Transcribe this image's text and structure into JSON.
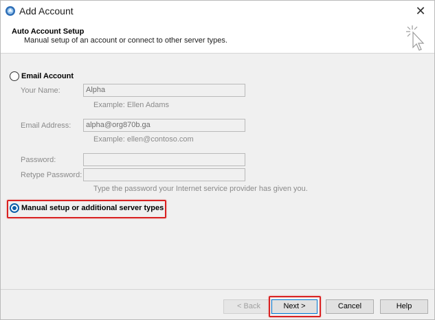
{
  "window": {
    "title": "Add Account",
    "close_glyph": "✕"
  },
  "header": {
    "title": "Auto Account Setup",
    "subtitle": "Manual setup of an account or connect to other server types.",
    "icon": "cursor-sparkle-icon"
  },
  "email_account": {
    "label": "Email Account",
    "selected": false,
    "your_name_label": "Your Name:",
    "your_name_value": "Alpha",
    "your_name_example": "Example: Ellen Adams",
    "email_label": "Email Address:",
    "email_value": "alpha@org870b.ga",
    "email_example": "Example: ellen@contoso.com",
    "password_label": "Password:",
    "password_value": "",
    "retype_label": "Retype Password:",
    "retype_value": "",
    "password_hint": "Type the password your Internet service provider has given you."
  },
  "manual_setup": {
    "label": "Manual setup or additional server types",
    "selected": true
  },
  "buttons": {
    "back": "< Back",
    "next": "Next >",
    "cancel": "Cancel",
    "help": "Help"
  },
  "colors": {
    "highlight": "#d92121",
    "accent": "#0e5ea8"
  }
}
